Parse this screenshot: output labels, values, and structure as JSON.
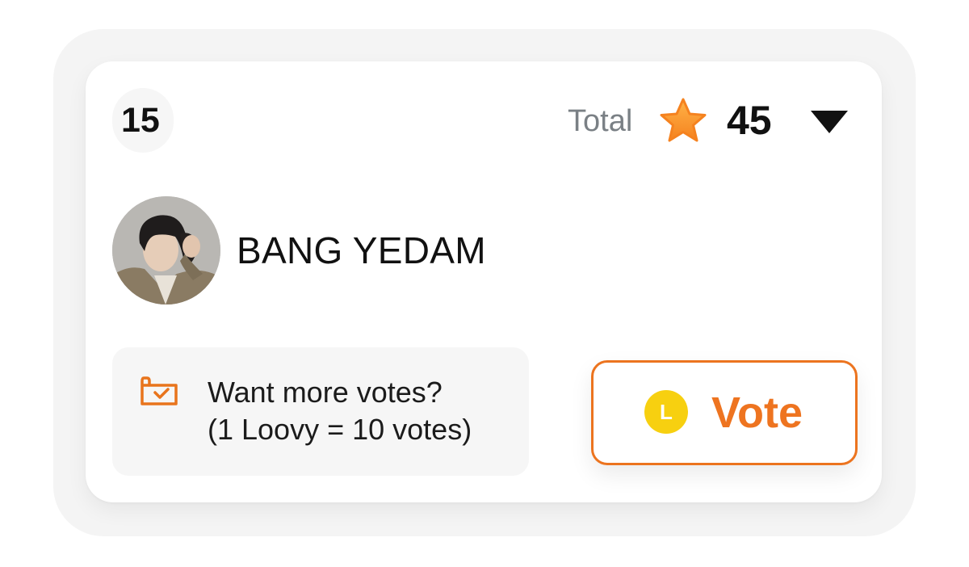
{
  "rank": "15",
  "total": {
    "label": "Total",
    "count": "45",
    "star_icon": "star-icon",
    "sort_icon": "caret-down-icon"
  },
  "artist": {
    "name": "BANG YEDAM",
    "avatar_icon": "artist-avatar"
  },
  "promo": {
    "icon": "ticket-check-icon",
    "line1": "Want more votes?",
    "line2": "(1 Loovy = 10 votes)"
  },
  "vote_button": {
    "label": "Vote",
    "coin_letter": "L",
    "coin_icon": "loovy-coin-icon"
  },
  "colors": {
    "accent_orange": "#ee7420",
    "coin_yellow": "#f7d010",
    "star_orange": "#fa9628"
  }
}
